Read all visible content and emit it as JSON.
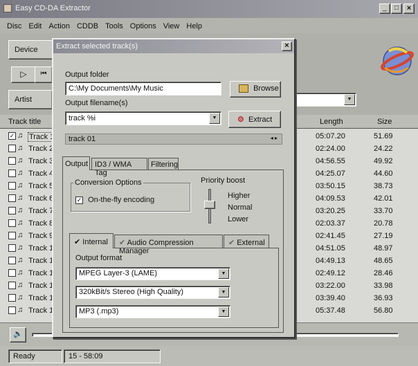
{
  "app": {
    "title": "Easy CD-DA Extractor",
    "window_controls": [
      "_",
      "□",
      "×"
    ],
    "menu": [
      "Disc",
      "Edit",
      "Action",
      "CDDB",
      "Tools",
      "Options",
      "View",
      "Help"
    ],
    "device_label": "Device",
    "artist_label": "Artist",
    "columns": {
      "track_title": "Track title",
      "length": "Length",
      "size": "Size"
    },
    "tracks": [
      {
        "title": "Track 1",
        "length": "05:07.20",
        "size": "51.69",
        "checked": true
      },
      {
        "title": "Track 2",
        "length": "02:24.00",
        "size": "24.22",
        "checked": false
      },
      {
        "title": "Track 3",
        "length": "04:56.55",
        "size": "49.92",
        "checked": false
      },
      {
        "title": "Track 4",
        "length": "04:25.07",
        "size": "44.60",
        "checked": false
      },
      {
        "title": "Track 5",
        "length": "03:50.15",
        "size": "38.73",
        "checked": false
      },
      {
        "title": "Track 6",
        "length": "04:09.53",
        "size": "42.01",
        "checked": false
      },
      {
        "title": "Track 7",
        "length": "03:20.25",
        "size": "33.70",
        "checked": false
      },
      {
        "title": "Track 8",
        "length": "02:03.37",
        "size": "20.78",
        "checked": false
      },
      {
        "title": "Track 9",
        "length": "02:41.45",
        "size": "27.19",
        "checked": false
      },
      {
        "title": "Track 1",
        "length": "04:51.05",
        "size": "48.97",
        "checked": false
      },
      {
        "title": "Track 1",
        "length": "04:49.13",
        "size": "48.65",
        "checked": false
      },
      {
        "title": "Track 1",
        "length": "02:49.12",
        "size": "28.46",
        "checked": false
      },
      {
        "title": "Track 1",
        "length": "03:22.00",
        "size": "33.98",
        "checked": false
      },
      {
        "title": "Track 1",
        "length": "03:39.40",
        "size": "36.93",
        "checked": false
      },
      {
        "title": "Track 1",
        "length": "05:37.48",
        "size": "56.80",
        "checked": false
      }
    ],
    "status": {
      "left": "Ready",
      "right": "15 - 58:09"
    }
  },
  "dialog": {
    "title": "Extract selected track(s)",
    "output_folder_label": "Output folder",
    "output_folder_value": "C:\\My Documents\\My Music",
    "browse_label": "Browse",
    "filename_label": "Output filename(s)",
    "filename_value": "track %i",
    "extract_label": "Extract",
    "preview": "track 01",
    "tabs": [
      "Output",
      "ID3 / WMA Tag",
      "Filtering"
    ],
    "conversion_options_label": "Conversion Options",
    "on_the_fly_label": "On-the-fly encoding",
    "priority_label": "Priority boost",
    "priority_levels": [
      "Higher",
      "Normal",
      "Lower"
    ],
    "priority_selected": "Normal",
    "subtabs": [
      "Internal",
      "Audio Compression Manager",
      "External"
    ],
    "output_format_label": "Output format",
    "encoder": "MPEG Layer-3 (LAME)",
    "bitrate": "320kBit/s Stereo (High Quality)",
    "container": "MP3 (.mp3)"
  },
  "colors": {
    "titlebar": "#8f8f98",
    "dialog_face": "#c9c9c3",
    "selection": "#c8c8c8"
  }
}
